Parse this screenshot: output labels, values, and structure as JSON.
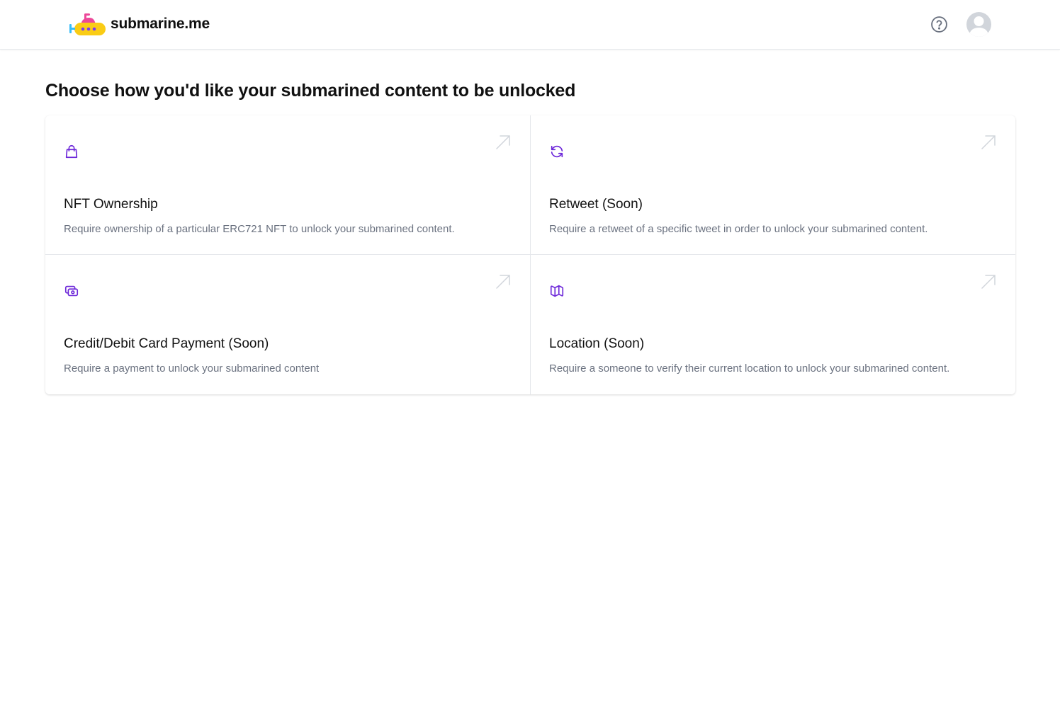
{
  "header": {
    "brand_name": "submarine.me",
    "logo_icon": "submarine-logo",
    "help_icon": "question-circle-icon",
    "avatar_icon": "user-avatar-icon"
  },
  "page": {
    "title": "Choose how you'd like your submarined content to be unlocked"
  },
  "colors": {
    "accent": "#6d28d9",
    "arrow": "#d1d5db",
    "description": "#6b7280"
  },
  "options": [
    {
      "icon": "shopping-bag-icon",
      "title": "NFT Ownership",
      "description": "Require ownership of a particular ERC721 NFT to unlock your submarined content."
    },
    {
      "icon": "refresh-icon",
      "title": "Retweet (Soon)",
      "description": "Require a retweet of a specific tweet in order to unlock your submarined content."
    },
    {
      "icon": "cash-icon",
      "title": "Credit/Debit Card Payment (Soon)",
      "description": "Require a payment to unlock your submarined content"
    },
    {
      "icon": "map-icon",
      "title": "Location (Soon)",
      "description": "Require a someone to verify their current location to unlock your submarined content."
    }
  ]
}
